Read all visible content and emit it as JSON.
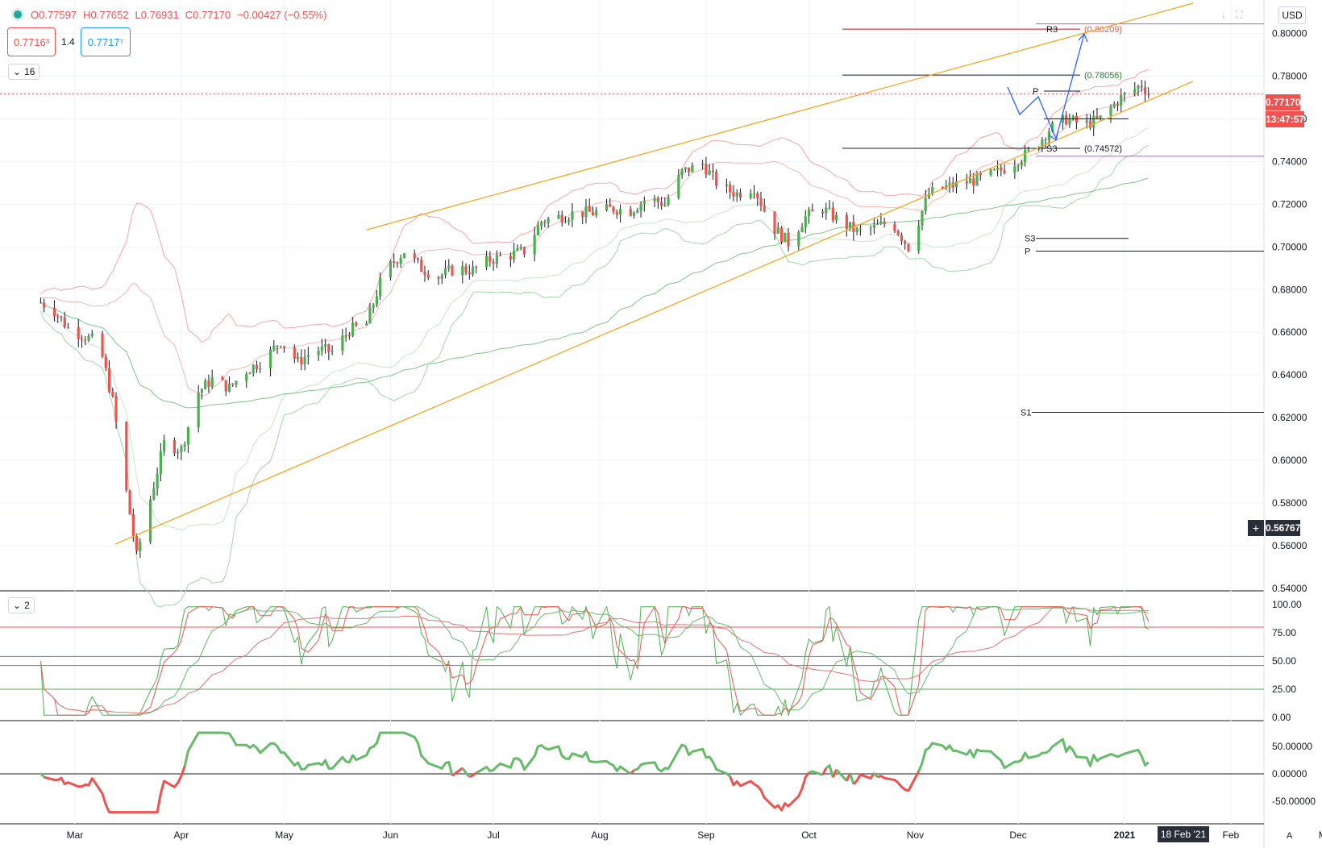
{
  "header": {
    "ohlc": {
      "o": "O0.77597",
      "h": "H0.77652",
      "l": "L0.76931",
      "c": "C0.77170",
      "chg": "−0.00427 (−0.55%)"
    },
    "bid": "0.7716³",
    "spread": "1.4",
    "ask": "0.7717⁷",
    "indicators_collapsed_count": "16",
    "pane2_collapsed_count": "2",
    "currency": "USD"
  },
  "tags": {
    "last_price": "0.77170",
    "countdown": "13:47:57",
    "crosshair_price": "0.56767",
    "crosshair_date": "18 Feb '21"
  },
  "colors": {
    "up": "#4caf50",
    "down": "#ef5350",
    "channel": "#f5a623",
    "projection": "#2962ff",
    "pivot_line": "#131722",
    "r3_line": "#b71c1c",
    "magenta": "#e040fb"
  },
  "chart_data": [
    {
      "type": "candlestick",
      "title": "",
      "x": [
        "2020-02-20",
        "2020-02-24",
        "2020-02-28",
        "2020-03-04",
        "2020-03-08",
        "2020-03-12",
        "2020-03-16",
        "2020-03-19",
        "2020-03-23",
        "2020-03-27",
        "2020-04-01",
        "2020-04-06",
        "2020-04-10",
        "2020-04-15",
        "2020-04-20",
        "2020-04-25",
        "2020-04-30",
        "2020-05-05",
        "2020-05-10",
        "2020-05-15",
        "2020-05-20",
        "2020-05-25",
        "2020-05-30",
        "2020-06-05",
        "2020-06-10",
        "2020-06-15",
        "2020-06-20",
        "2020-06-25",
        "2020-06-30",
        "2020-07-05",
        "2020-07-10",
        "2020-07-15",
        "2020-07-20",
        "2020-07-25",
        "2020-07-30",
        "2020-08-05",
        "2020-08-10",
        "2020-08-15",
        "2020-08-20",
        "2020-08-25",
        "2020-08-31",
        "2020-09-05",
        "2020-09-10",
        "2020-09-15",
        "2020-09-20",
        "2020-09-25",
        "2020-09-30",
        "2020-10-05",
        "2020-10-10",
        "2020-10-15",
        "2020-10-20",
        "2020-10-25",
        "2020-10-30",
        "2020-11-05",
        "2020-11-10",
        "2020-11-15",
        "2020-11-20",
        "2020-11-25",
        "2020-11-30",
        "2020-12-05",
        "2020-12-10",
        "2020-12-15",
        "2020-12-20",
        "2020-12-25",
        "2020-12-31",
        "2021-01-06",
        "2021-01-08"
      ],
      "close": [
        0.674,
        0.67,
        0.662,
        0.658,
        0.655,
        0.628,
        0.585,
        0.555,
        0.582,
        0.608,
        0.605,
        0.632,
        0.638,
        0.634,
        0.642,
        0.647,
        0.656,
        0.646,
        0.652,
        0.651,
        0.661,
        0.664,
        0.688,
        0.698,
        0.69,
        0.686,
        0.69,
        0.689,
        0.694,
        0.696,
        0.698,
        0.712,
        0.714,
        0.716,
        0.716,
        0.718,
        0.717,
        0.723,
        0.72,
        0.735,
        0.739,
        0.728,
        0.725,
        0.728,
        0.71,
        0.702,
        0.714,
        0.718,
        0.712,
        0.707,
        0.709,
        0.712,
        0.7,
        0.725,
        0.728,
        0.73,
        0.732,
        0.735,
        0.74,
        0.745,
        0.755,
        0.76,
        0.757,
        0.76,
        0.77,
        0.776,
        0.7717
      ],
      "ylim": [
        0.54,
        0.81
      ],
      "y_ticks": [
        "0.80000",
        "0.78000",
        "0.76000",
        "0.74000",
        "0.72000",
        "0.70000",
        "0.68000",
        "0.66000",
        "0.64000",
        "0.62000",
        "0.60000",
        "0.58000",
        "0.56000",
        "0.54000"
      ],
      "x_ticks": [
        "Mar",
        "Apr",
        "May",
        "Jun",
        "Jul",
        "Aug",
        "Sep",
        "Oct",
        "Nov",
        "Dec",
        "2021",
        "Feb",
        "Mar"
      ],
      "levels": [
        {
          "label": "R3",
          "value": 0.802,
          "text": "(0.80209)"
        },
        {
          "label": "",
          "value": 0.7805,
          "text": "(0.78056)"
        },
        {
          "label": "P",
          "value": 0.773,
          "text": ""
        },
        {
          "label": "",
          "value": 0.76,
          "text": ""
        },
        {
          "label": "S3",
          "value": 0.7462,
          "text": "(0.74572)"
        },
        {
          "label": "S3",
          "value": 0.704,
          "text": ""
        },
        {
          "label": "P",
          "value": 0.698,
          "text": ""
        },
        {
          "label": "S1",
          "value": 0.6225,
          "text": ""
        }
      ],
      "magenta_levels": [
        0.8045,
        0.7425
      ]
    },
    {
      "type": "line",
      "title": "",
      "ylim": [
        0,
        100
      ],
      "y_ticks": [
        "100.00",
        "75.00",
        "50.00",
        "25.00",
        "0.00"
      ],
      "horizontal_levels": [
        80,
        54,
        46,
        25
      ]
    },
    {
      "type": "area",
      "title": "",
      "ylim": [
        -75,
        75
      ],
      "y_ticks": [
        "50.00000",
        "0.00000",
        "-50.00000"
      ]
    }
  ]
}
